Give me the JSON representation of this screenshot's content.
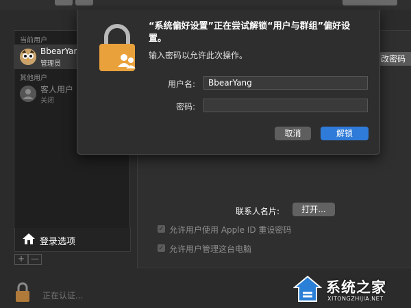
{
  "sidebar": {
    "current_users_header": "当前用户",
    "current_user": {
      "name": "BbearYang",
      "role": "管理员",
      "avatar": "owl-avatar"
    },
    "other_users_header": "其他用户",
    "guest_user": {
      "name": "客人用户",
      "role": "关闭",
      "avatar": "person-icon"
    },
    "login_options_label": "登录选项",
    "add_label": "+",
    "remove_label": "—"
  },
  "main": {
    "change_password_label": "改密码",
    "contact_card_label": "联系人名片:",
    "open_button_label": "打开...",
    "checkboxes": [
      {
        "label": "允许用户使用 Apple ID 重设密码",
        "checked": true
      },
      {
        "label": "允许用户管理这台电脑",
        "checked": true
      }
    ]
  },
  "status": {
    "authenticating_text": "正在认证..."
  },
  "dialog": {
    "title": "“系统偏好设置”正在尝试解锁“用户与群组”偏好设置。",
    "subtitle": "输入密码以允许此次操作。",
    "username_label": "用户名:",
    "username_value": "BbearYang",
    "password_label": "密码:",
    "password_value": "",
    "cancel_label": "取消",
    "unlock_label": "解锁"
  },
  "watermark": {
    "text": "系统之家",
    "url": "XITONGZHIJIA.NET"
  },
  "colors": {
    "accent": "#2f7bd9",
    "lock_orange": "#e9a13b",
    "watermark_blue": "#2a7fd6"
  }
}
